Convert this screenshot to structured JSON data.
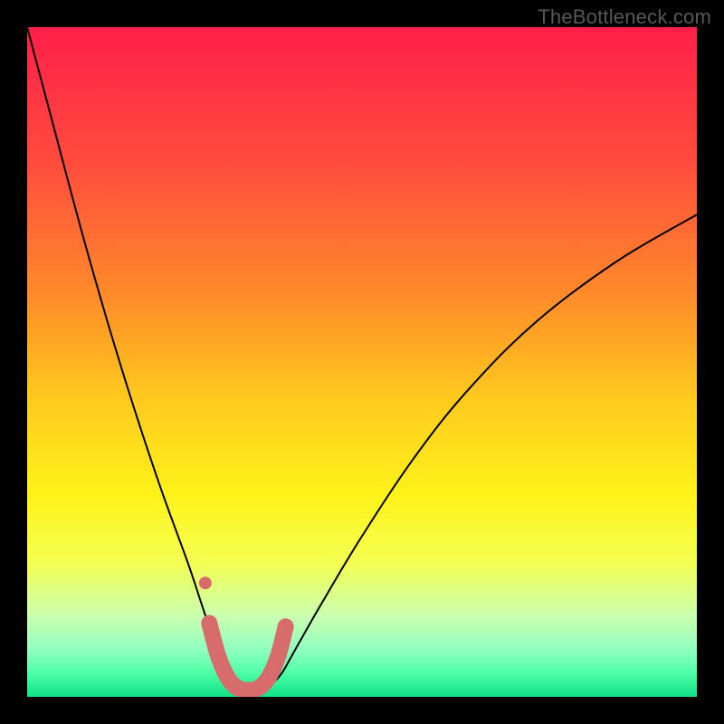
{
  "watermark": "TheBottleneck.com",
  "chart_data": {
    "type": "line",
    "title": "",
    "xlabel": "",
    "ylabel": "",
    "xlim": [
      0,
      100
    ],
    "ylim": [
      0,
      100
    ],
    "grid": false,
    "legend": false,
    "background": {
      "type": "vertical-gradient",
      "stops": [
        {
          "pos": 0.0,
          "color": "#ff1f4a"
        },
        {
          "pos": 0.2,
          "color": "#ff4b3d"
        },
        {
          "pos": 0.4,
          "color": "#ff8b2a"
        },
        {
          "pos": 0.55,
          "color": "#ffc81e"
        },
        {
          "pos": 0.7,
          "color": "#fff31a"
        },
        {
          "pos": 0.8,
          "color": "#f4ff52"
        },
        {
          "pos": 0.88,
          "color": "#caffb0"
        },
        {
          "pos": 0.93,
          "color": "#8fffc0"
        },
        {
          "pos": 0.965,
          "color": "#4dffa6"
        },
        {
          "pos": 1.0,
          "color": "#0fe187"
        }
      ]
    },
    "series": [
      {
        "name": "bottleneck-curve",
        "color": "#000000",
        "stroke_width": 2,
        "x": [
          0,
          4,
          8,
          12,
          16,
          20,
          24,
          26,
          28,
          29.5,
          30.5,
          32,
          33.5,
          35,
          36.5,
          38,
          40,
          44,
          50,
          58,
          66,
          76,
          88,
          100
        ],
        "y": [
          100,
          85,
          70,
          56,
          43,
          31,
          20,
          14,
          8,
          3.5,
          2.0,
          1.2,
          1.0,
          1.2,
          2.0,
          3.5,
          7,
          14,
          24,
          36,
          46,
          56,
          65,
          72
        ]
      },
      {
        "name": "valley-highlight",
        "color": "#d86b6b",
        "stroke_width": 18,
        "linecap": "round",
        "x": [
          27.2,
          28.4,
          29.6,
          30.8,
          32.0,
          33.0,
          34.0,
          35.2,
          36.4,
          37.6,
          38.6
        ],
        "y": [
          11.0,
          6.5,
          3.5,
          1.8,
          1.1,
          1.0,
          1.1,
          1.8,
          3.5,
          6.5,
          10.5
        ]
      },
      {
        "name": "highlight-dot",
        "type": "scatter",
        "color": "#d86b6b",
        "radius": 7,
        "x": [
          26.6
        ],
        "y": [
          17.0
        ]
      }
    ]
  }
}
